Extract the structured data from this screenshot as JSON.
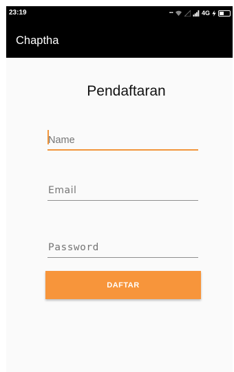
{
  "status_bar": {
    "time": "23:19",
    "dots": "...",
    "network": "4G",
    "battery_level": 0.4
  },
  "app_bar": {
    "title": "Chaptha"
  },
  "form": {
    "title": "Pendaftaran",
    "name": {
      "placeholder": "Name",
      "value": ""
    },
    "email": {
      "placeholder": "Email",
      "value": ""
    },
    "password": {
      "placeholder": "Password",
      "value": ""
    },
    "submit_label": "DAFTAR"
  },
  "colors": {
    "accent": "#f7953b",
    "app_bar": "#000000",
    "background": "#fafafa"
  }
}
